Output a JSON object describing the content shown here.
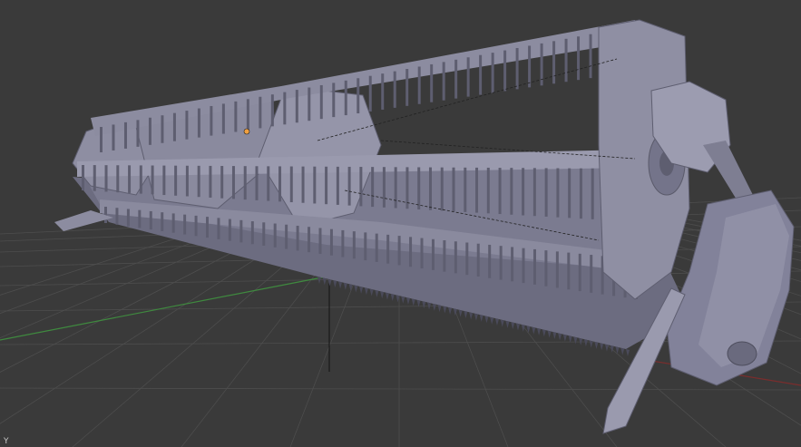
{
  "viewport": {
    "background": "#3a3a3a",
    "grid_color": "#4d4d4d",
    "x_axis_color": "#7a2d2d",
    "y_axis_color": "#3f8a3f",
    "model_color": "#8a8a9e",
    "model_light": "#a4a4b6",
    "model_dark": "#5e5e70",
    "origin_color": "#f0a040",
    "axis_indicator_label": "Y"
  },
  "scene": {
    "object": "combine-header-3d-model",
    "icons": [
      "origin-dot-icon",
      "axis-gizmo-icon"
    ]
  }
}
